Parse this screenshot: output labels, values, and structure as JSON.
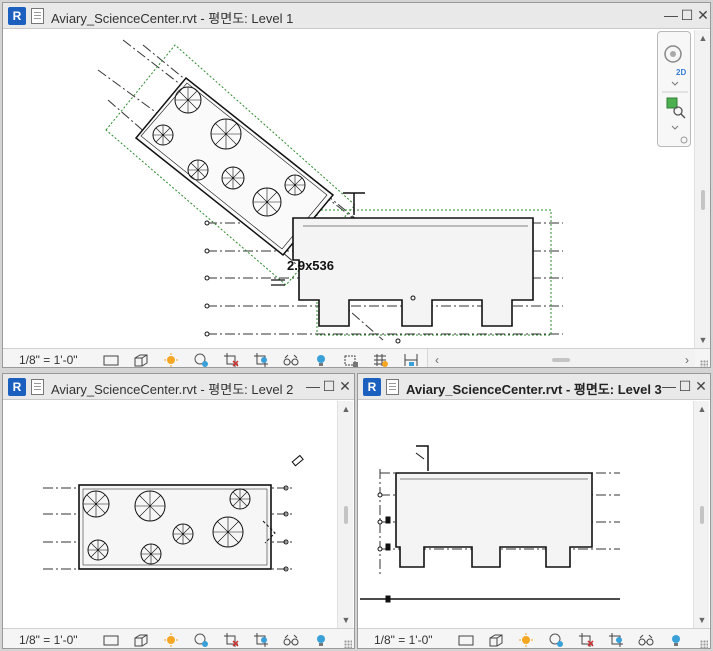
{
  "app": {
    "logo_letter": "R"
  },
  "windows": [
    {
      "id": "level1",
      "title": "Aviary_ScienceCenter.rvt - 평면도: Level 1",
      "scale": "1/8\" = 1'-0\"",
      "active": false
    },
    {
      "id": "level2",
      "title": "Aviary_ScienceCenter.rvt - 평면도: Level 2",
      "scale": "1/8\" = 1'-0\"",
      "active": false
    },
    {
      "id": "level3",
      "title": "Aviary_ScienceCenter.rvt - 평면도: Level 3",
      "scale": "1/8\" = 1'-0\"",
      "active": true
    }
  ],
  "window_controls": {
    "minimize": "—",
    "maximize": "☐",
    "close": "✕"
  },
  "drawing_annotations": {
    "level1_dimension": "2.9x536"
  },
  "navigation_bar": {
    "icons": [
      "2d-steering-wheel-icon",
      "zoom-region-icon"
    ],
    "wheel_label": "2D"
  },
  "view_control_icons": [
    "detail-level-icon",
    "visual-style-icon",
    "sun-path-icon",
    "shadows-icon",
    "crop-view-icon",
    "show-crop-region-icon",
    "temporary-hide-icon",
    "reveal-hidden-icon",
    "lock-3d-view-icon",
    "analysis-display-icon",
    "highlight-displacement-icon"
  ],
  "colors": {
    "accent": "#1b5fbf",
    "crop_region": "#2e8b2e",
    "linework": "#111111"
  }
}
